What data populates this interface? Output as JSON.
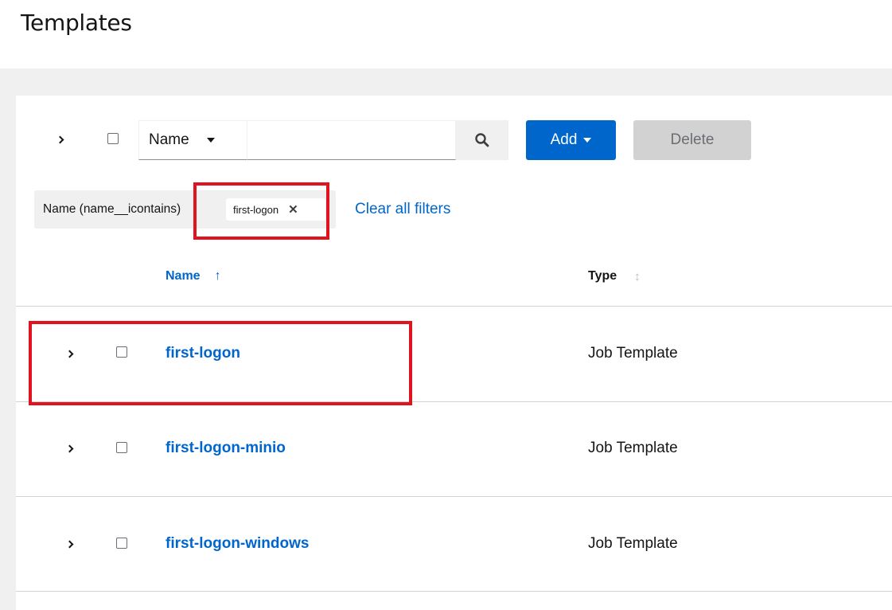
{
  "page": {
    "title": "Templates"
  },
  "toolbar": {
    "filter_attribute": "Name",
    "search_value": "",
    "add_label": "Add",
    "delete_label": "Delete"
  },
  "filters": {
    "category": "Name (name__icontains)",
    "chip": "first-logon",
    "chip_remove": "✕",
    "clear_label": "Clear all filters"
  },
  "table": {
    "columns": [
      "Name",
      "Type"
    ],
    "rows": [
      {
        "name": "first-logon",
        "type": "Job Template"
      },
      {
        "name": "first-logon-minio",
        "type": "Job Template"
      },
      {
        "name": "first-logon-windows",
        "type": "Job Template"
      }
    ]
  },
  "colors": {
    "link": "#0066cc",
    "highlight": "#e0141e",
    "background": "#f0f0f0"
  }
}
